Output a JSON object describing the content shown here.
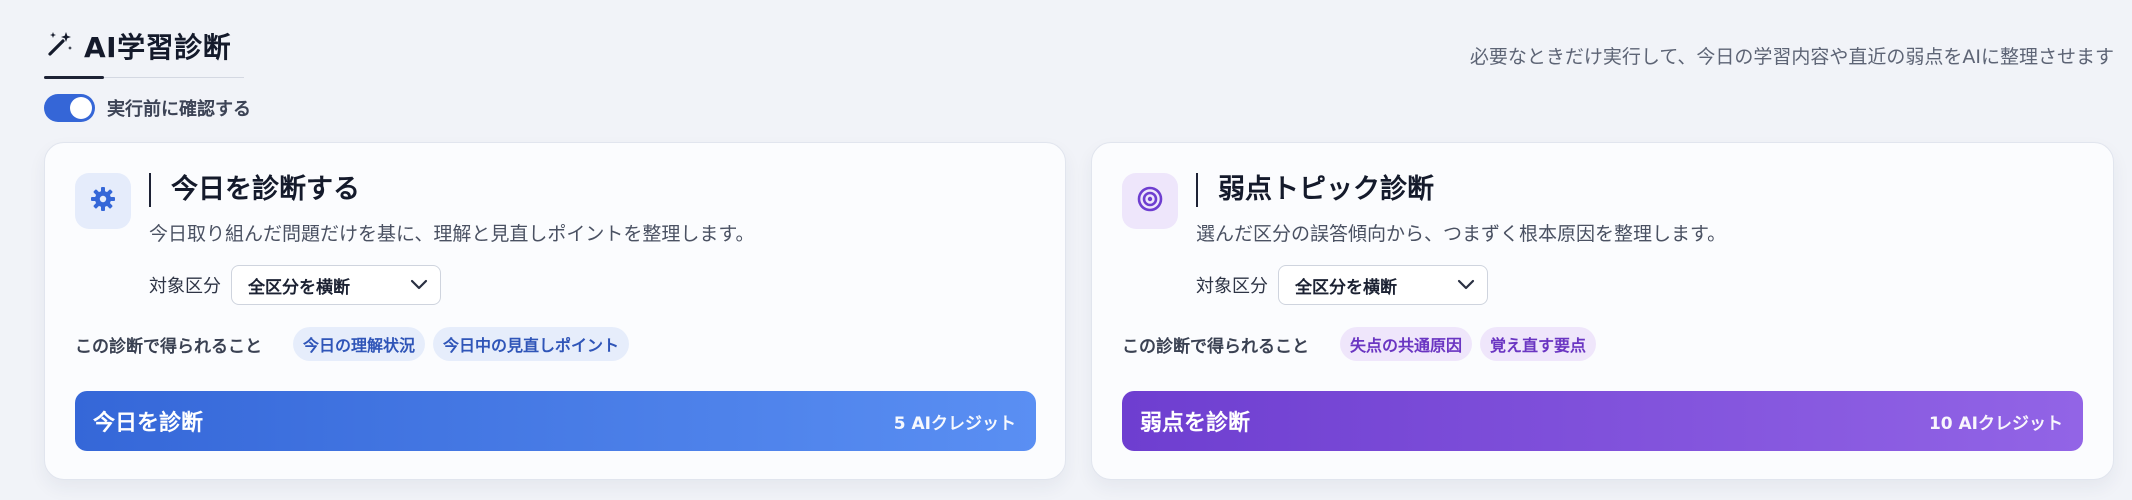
{
  "header": {
    "tab_title": "AI学習診断",
    "description": "必要なときだけ実行して、今日の学習内容や直近の弱点をAIに整理させます"
  },
  "confirm_toggle": {
    "label": "実行前に確認する",
    "on": true
  },
  "cards": {
    "today": {
      "title": "今日を診断する",
      "description": "今日取り組んだ問題だけを基に、理解と見直しポイントを整理します。",
      "target_label": "対象区分",
      "target_value": "全区分を横断",
      "benefits_label": "この診断で得られること",
      "benefits": [
        "今日の理解状況",
        "今日中の見直しポイント"
      ],
      "button_label": "今日を診断",
      "button_cost": "5 AIクレジット"
    },
    "weak": {
      "title": "弱点トピック診断",
      "description": "選んだ区分の誤答傾向から、つまずく根本原因を整理します。",
      "target_label": "対象区分",
      "target_value": "全区分を横断",
      "benefits_label": "この診断で得られること",
      "benefits": [
        "失点の共通原因",
        "覚え直す要点"
      ],
      "button_label": "弱点を診断",
      "button_cost": "10 AIクレジット"
    }
  },
  "colors": {
    "today_accent": "#3567d8",
    "weak_accent": "#6e3ed0",
    "toggle_on": "#3566d7"
  },
  "icons": {
    "tab": "magic-wand-icon",
    "today": "gear-icon",
    "weak": "target-icon",
    "select": "chevron-down-icon"
  }
}
